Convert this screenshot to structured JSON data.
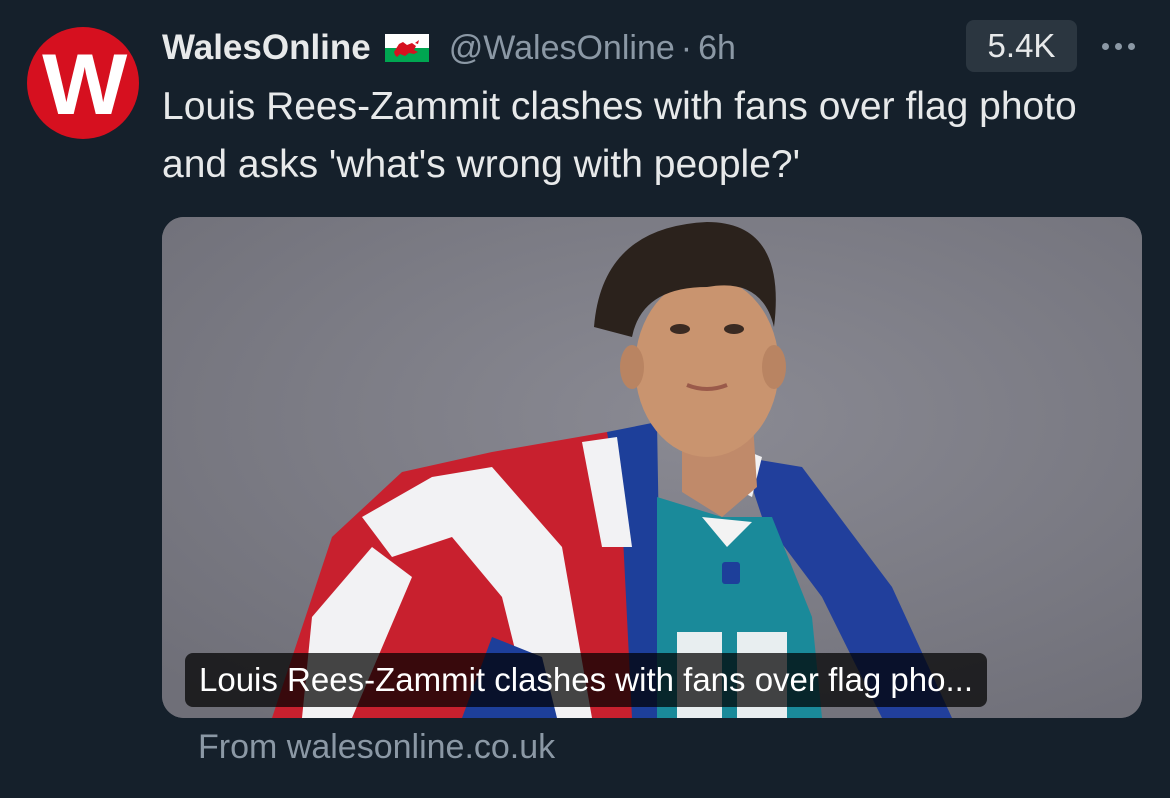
{
  "tweet": {
    "author": {
      "display_name": "WalesOnline",
      "avatar_letter": "W",
      "badge_icon": "wales-flag-icon",
      "handle": "@WalesOnline",
      "separator": "·",
      "time": "6h"
    },
    "views": "5.4K",
    "more_icon": "more-dots-icon",
    "text": "Louis Rees-Zammit clashes with fans over flag photo and asks 'what's wrong with people?'",
    "card": {
      "title": "Louis Rees-Zammit clashes with fans over flag pho...",
      "source": "From walesonline.co.uk"
    }
  },
  "colors": {
    "background": "#15202b",
    "avatar": "#d6101f",
    "primary_text": "#e7e9ea",
    "secondary_text": "#8b98a5",
    "badge_bg": "#2b3640"
  }
}
